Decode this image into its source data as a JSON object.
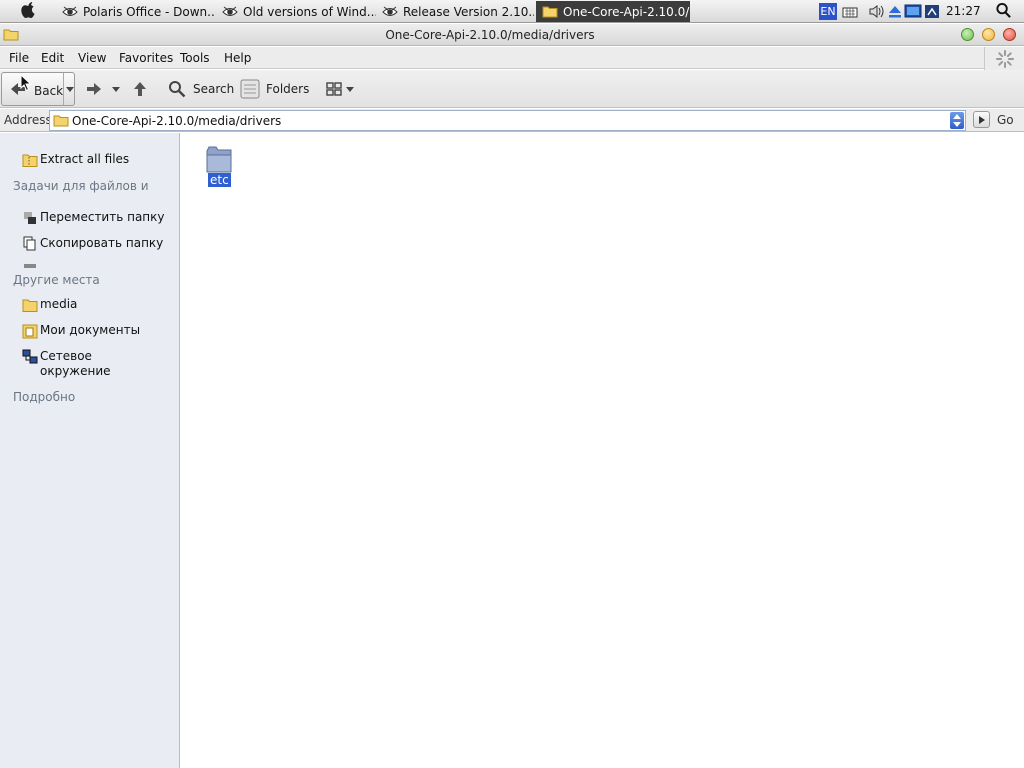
{
  "taskbar": {
    "tasks": [
      {
        "label": "Polaris Office - Down...",
        "active": false
      },
      {
        "label": "Old versions of Wind...",
        "active": false
      },
      {
        "label": "Release Version 2.10....",
        "active": false
      },
      {
        "label": "One-Core-Api-2.10.0/...",
        "active": true
      }
    ],
    "language": "EN",
    "clock": "21:27"
  },
  "window": {
    "title": "One-Core-Api-2.10.0/media/drivers"
  },
  "menu": {
    "items": [
      "File",
      "Edit",
      "View",
      "Favorites",
      "Tools",
      "Help"
    ]
  },
  "toolbar": {
    "back_label": "Back",
    "search_label": "Search",
    "folders_label": "Folders"
  },
  "address": {
    "label": "Address",
    "value": "One-Core-Api-2.10.0/media/drivers",
    "go_label": "Go"
  },
  "taskpane": {
    "extract_label": "Extract all files",
    "file_tasks_heading": "Задачи для файлов и папок",
    "move_label": "Переместить папку",
    "copy_label": "Скопировать папку",
    "other_places_heading": "Другие места",
    "places": [
      "media",
      "Мои документы",
      "Сетевое окружение"
    ],
    "details_heading": "Подробно"
  },
  "files": [
    {
      "name": "etc",
      "type": "folder",
      "selected": true
    }
  ],
  "colors": {
    "selection": "#2f5fd1",
    "pane_bg": "#e9edf3",
    "active_task": "#3c3c3c"
  }
}
